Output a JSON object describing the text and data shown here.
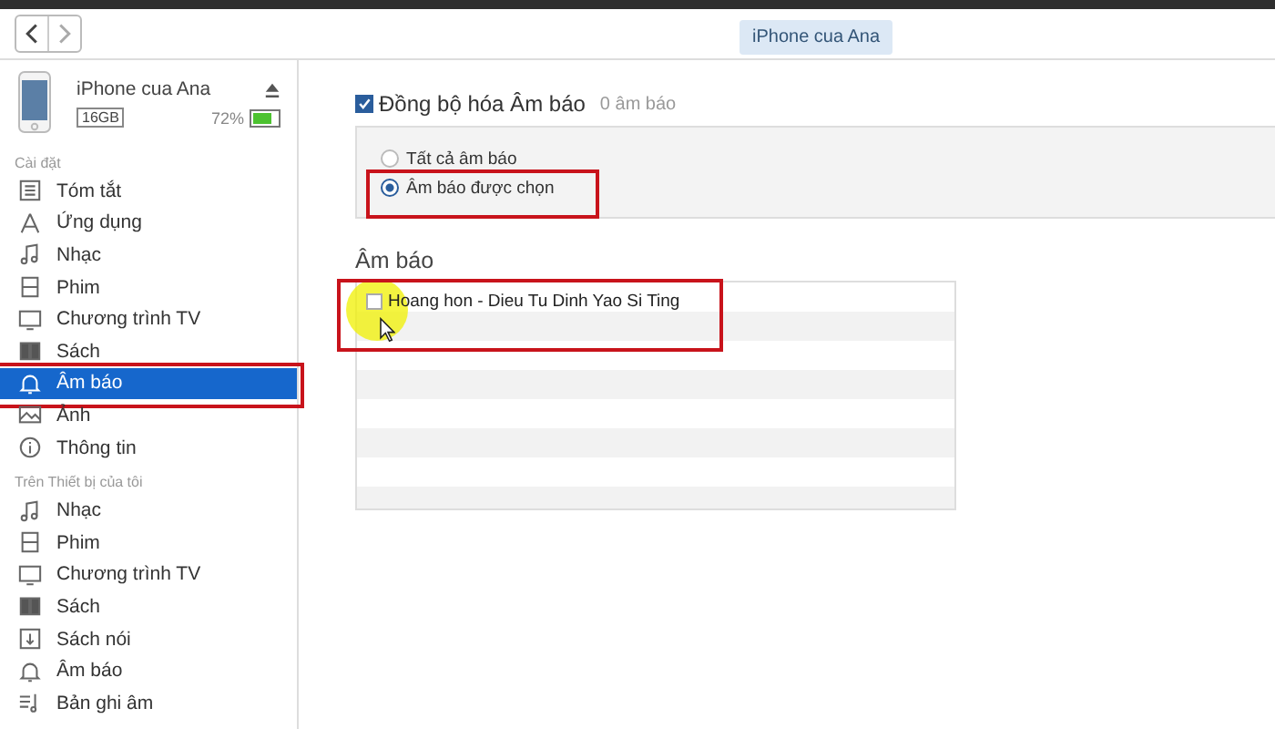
{
  "toolbar": {
    "device_button": "iPhone cua Ana"
  },
  "device": {
    "name": "iPhone cua Ana",
    "capacity": "16GB",
    "battery_percent": "72%"
  },
  "sidebar": {
    "sections": [
      {
        "title": "Cài đặt",
        "items": [
          {
            "kind": "summary",
            "label": "Tóm tắt",
            "selected": false,
            "highlighted": false
          },
          {
            "kind": "apps",
            "label": "Ứng dụng",
            "selected": false,
            "highlighted": false
          },
          {
            "kind": "music",
            "label": "Nhạc",
            "selected": false,
            "highlighted": false
          },
          {
            "kind": "movies",
            "label": "Phim",
            "selected": false,
            "highlighted": false
          },
          {
            "kind": "tv",
            "label": "Chương trình TV",
            "selected": false,
            "highlighted": false
          },
          {
            "kind": "books",
            "label": "Sách",
            "selected": false,
            "highlighted": false
          },
          {
            "kind": "tones",
            "label": "Âm báo",
            "selected": true,
            "highlighted": true
          },
          {
            "kind": "photos",
            "label": "Ảnh",
            "selected": false,
            "highlighted": false
          },
          {
            "kind": "info",
            "label": "Thông tin",
            "selected": false,
            "highlighted": false
          }
        ]
      },
      {
        "title": "Trên Thiết bị của tôi",
        "items": [
          {
            "kind": "music",
            "label": "Nhạc",
            "selected": false,
            "highlighted": false
          },
          {
            "kind": "movies",
            "label": "Phim",
            "selected": false,
            "highlighted": false
          },
          {
            "kind": "tv",
            "label": "Chương trình TV",
            "selected": false,
            "highlighted": false
          },
          {
            "kind": "books",
            "label": "Sách",
            "selected": false,
            "highlighted": false
          },
          {
            "kind": "audiobooks",
            "label": "Sách nói",
            "selected": false,
            "highlighted": false
          },
          {
            "kind": "tones",
            "label": "Âm báo",
            "selected": false,
            "highlighted": false
          },
          {
            "kind": "voice-memos",
            "label": "Bản ghi âm",
            "selected": false,
            "highlighted": false
          }
        ]
      }
    ]
  },
  "sync": {
    "label": "Đồng bộ hóa Âm báo",
    "checked": true,
    "count": "0 âm báo",
    "options": [
      {
        "label": "Tất cả âm báo",
        "selected": false,
        "highlighted": false
      },
      {
        "label": "Âm báo được chọn",
        "selected": true,
        "highlighted": true
      }
    ]
  },
  "tones": {
    "heading": "Âm báo",
    "rows": [
      {
        "label": "Hoang hon - Dieu Tu Dinh Yao Si Ting",
        "checked": false,
        "highlighted": true
      }
    ]
  }
}
